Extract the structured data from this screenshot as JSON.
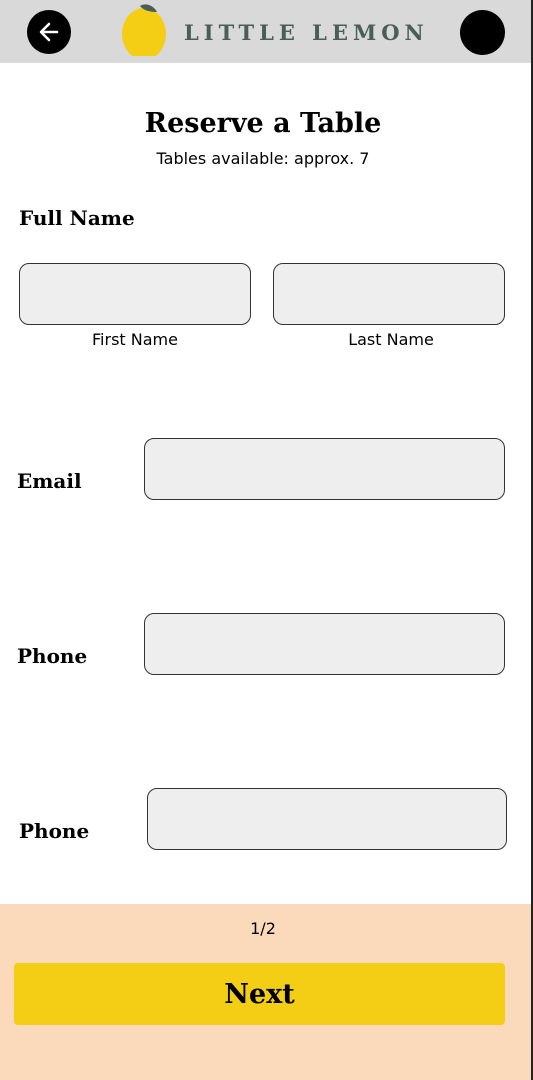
{
  "header": {
    "brand": "LITTLE LEMON",
    "back_icon": "arrow-left-icon",
    "profile_icon": "avatar"
  },
  "main": {
    "title": "Reserve a Table",
    "subtitle": "Tables available: approx. 7",
    "full_name_label": "Full Name",
    "first_name_caption": "First Name",
    "last_name_caption": "Last Name",
    "first_name_value": "",
    "last_name_value": "",
    "email_label": "Email",
    "email_value": "",
    "phone_label": "Phone",
    "phone_value": "",
    "phone2_label": "Phone",
    "phone2_value": ""
  },
  "footer": {
    "pager": "1/2",
    "next_label": "Next"
  },
  "colors": {
    "header_bg": "#d9d9d9",
    "brand_text": "#495e57",
    "lemon": "#f4ce14",
    "footer_bg": "#fbdabb",
    "field_bg": "#edeeed",
    "button_bg": "#f4ce14"
  }
}
